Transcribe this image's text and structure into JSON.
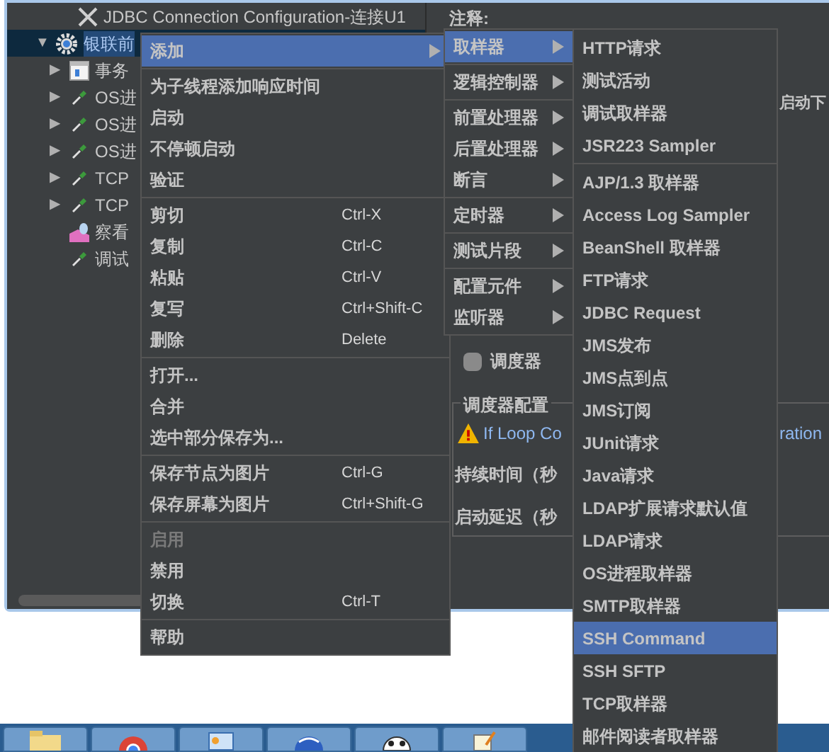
{
  "tree": [
    {
      "label": "JDBC Connection Configuration-连接U1",
      "kind": "config",
      "selected": false
    },
    {
      "label": "银联前",
      "kind": "thread-group",
      "toggle": "▼",
      "selected": true
    },
    {
      "label": "事务",
      "kind": "controller",
      "toggle": "▶",
      "selected": false
    },
    {
      "label": "OS进",
      "kind": "sampler",
      "toggle": "▶",
      "selected": false
    },
    {
      "label": "OS进",
      "kind": "sampler",
      "toggle": "▶",
      "selected": false
    },
    {
      "label": "OS进",
      "kind": "sampler",
      "toggle": "▶",
      "selected": false
    },
    {
      "label": "TCP",
      "kind": "sampler",
      "toggle": "▶",
      "selected": false
    },
    {
      "label": "TCP",
      "kind": "sampler",
      "toggle": "▶",
      "selected": false
    },
    {
      "label": "察看",
      "kind": "listener",
      "selected": false
    },
    {
      "label": "调试",
      "kind": "sampler",
      "selected": false
    }
  ],
  "right_panel": {
    "comment_label": "注释:",
    "next_label": "启动下",
    "scheduler_checkbox": {
      "label": "调度器",
      "checked": false
    },
    "scheduler_group": "调度器配置",
    "warning_start": "If Loop Co",
    "warning_end": "ration",
    "duration_label": "持续时间（秒",
    "delay_label": "启动延迟（秒"
  },
  "context_menu": [
    {
      "kind": "item",
      "label": "添加",
      "submenu": true,
      "selected": true,
      "disabled": false
    },
    {
      "kind": "separator"
    },
    {
      "kind": "item",
      "label": "为子线程添加响应时间",
      "submenu": false,
      "selected": false,
      "disabled": false
    },
    {
      "kind": "item",
      "label": "启动",
      "submenu": false,
      "selected": false,
      "disabled": false
    },
    {
      "kind": "item",
      "label": "不停顿启动",
      "submenu": false,
      "selected": false,
      "disabled": false
    },
    {
      "kind": "item",
      "label": "验证",
      "submenu": false,
      "selected": false,
      "disabled": false
    },
    {
      "kind": "separator"
    },
    {
      "kind": "item",
      "label": "剪切",
      "shortcut": "Ctrl-X",
      "submenu": false,
      "selected": false,
      "disabled": false
    },
    {
      "kind": "item",
      "label": "复制",
      "shortcut": "Ctrl-C",
      "submenu": false,
      "selected": false,
      "disabled": false
    },
    {
      "kind": "item",
      "label": "粘贴",
      "shortcut": "Ctrl-V",
      "submenu": false,
      "selected": false,
      "disabled": false
    },
    {
      "kind": "item",
      "label": "复写",
      "shortcut": "Ctrl+Shift-C",
      "submenu": false,
      "selected": false,
      "disabled": false
    },
    {
      "kind": "item",
      "label": "删除",
      "shortcut": "Delete",
      "submenu": false,
      "selected": false,
      "disabled": false
    },
    {
      "kind": "separator"
    },
    {
      "kind": "item",
      "label": "打开...",
      "submenu": false,
      "selected": false,
      "disabled": false
    },
    {
      "kind": "item",
      "label": "合并",
      "submenu": false,
      "selected": false,
      "disabled": false
    },
    {
      "kind": "item",
      "label": "选中部分保存为...",
      "submenu": false,
      "selected": false,
      "disabled": false
    },
    {
      "kind": "separator"
    },
    {
      "kind": "item",
      "label": "保存节点为图片",
      "shortcut": "Ctrl-G",
      "submenu": false,
      "selected": false,
      "disabled": false
    },
    {
      "kind": "item",
      "label": "保存屏幕为图片",
      "shortcut": "Ctrl+Shift-G",
      "submenu": false,
      "selected": false,
      "disabled": false
    },
    {
      "kind": "separator"
    },
    {
      "kind": "item",
      "label": "启用",
      "submenu": false,
      "selected": false,
      "disabled": true
    },
    {
      "kind": "item",
      "label": "禁用",
      "submenu": false,
      "selected": false,
      "disabled": false
    },
    {
      "kind": "item",
      "label": "切换",
      "shortcut": "Ctrl-T",
      "submenu": false,
      "selected": false,
      "disabled": false
    },
    {
      "kind": "separator"
    },
    {
      "kind": "item",
      "label": "帮助",
      "submenu": false,
      "selected": false,
      "disabled": false
    }
  ],
  "add_submenu": [
    {
      "kind": "item",
      "label": "取样器",
      "submenu": true,
      "selected": true,
      "disabled": false
    },
    {
      "kind": "separator"
    },
    {
      "kind": "item",
      "label": "逻辑控制器",
      "submenu": true,
      "selected": false,
      "disabled": false
    },
    {
      "kind": "separator"
    },
    {
      "kind": "item",
      "label": "前置处理器",
      "submenu": true,
      "selected": false,
      "disabled": false
    },
    {
      "kind": "item",
      "label": "后置处理器",
      "submenu": true,
      "selected": false,
      "disabled": false
    },
    {
      "kind": "item",
      "label": "断言",
      "submenu": true,
      "selected": false,
      "disabled": false
    },
    {
      "kind": "separator"
    },
    {
      "kind": "item",
      "label": "定时器",
      "submenu": true,
      "selected": false,
      "disabled": false
    },
    {
      "kind": "separator"
    },
    {
      "kind": "item",
      "label": "测试片段",
      "submenu": true,
      "selected": false,
      "disabled": false
    },
    {
      "kind": "separator"
    },
    {
      "kind": "item",
      "label": "配置元件",
      "submenu": true,
      "selected": false,
      "disabled": false
    },
    {
      "kind": "item",
      "label": "监听器",
      "submenu": true,
      "selected": false,
      "disabled": false
    }
  ],
  "sampler_submenu": [
    {
      "kind": "item",
      "label": "HTTP请求",
      "submenu": false,
      "selected": false,
      "disabled": false
    },
    {
      "kind": "item",
      "label": "测试活动",
      "submenu": false,
      "selected": false,
      "disabled": false
    },
    {
      "kind": "item",
      "label": "调试取样器",
      "submenu": false,
      "selected": false,
      "disabled": false
    },
    {
      "kind": "item",
      "label": "JSR223 Sampler",
      "submenu": false,
      "selected": false,
      "disabled": false
    },
    {
      "kind": "separator"
    },
    {
      "kind": "item",
      "label": "AJP/1.3 取样器",
      "submenu": false,
      "selected": false,
      "disabled": false
    },
    {
      "kind": "item",
      "label": "Access Log Sampler",
      "submenu": false,
      "selected": false,
      "disabled": false
    },
    {
      "kind": "item",
      "label": "BeanShell 取样器",
      "submenu": false,
      "selected": false,
      "disabled": false
    },
    {
      "kind": "item",
      "label": "FTP请求",
      "submenu": false,
      "selected": false,
      "disabled": false
    },
    {
      "kind": "item",
      "label": "JDBC Request",
      "submenu": false,
      "selected": false,
      "disabled": false
    },
    {
      "kind": "item",
      "label": "JMS发布",
      "submenu": false,
      "selected": false,
      "disabled": false
    },
    {
      "kind": "item",
      "label": "JMS点到点",
      "submenu": false,
      "selected": false,
      "disabled": false
    },
    {
      "kind": "item",
      "label": "JMS订阅",
      "submenu": false,
      "selected": false,
      "disabled": false
    },
    {
      "kind": "item",
      "label": "JUnit请求",
      "submenu": false,
      "selected": false,
      "disabled": false
    },
    {
      "kind": "item",
      "label": "Java请求",
      "submenu": false,
      "selected": false,
      "disabled": false
    },
    {
      "kind": "item",
      "label": "LDAP扩展请求默认值",
      "submenu": false,
      "selected": false,
      "disabled": false
    },
    {
      "kind": "item",
      "label": "LDAP请求",
      "submenu": false,
      "selected": false,
      "disabled": false
    },
    {
      "kind": "item",
      "label": "OS进程取样器",
      "submenu": false,
      "selected": false,
      "disabled": false
    },
    {
      "kind": "item",
      "label": "SMTP取样器",
      "submenu": false,
      "selected": false,
      "disabled": false
    },
    {
      "kind": "item",
      "label": "SSH Command",
      "submenu": false,
      "selected": true,
      "disabled": false
    },
    {
      "kind": "item",
      "label": "SSH SFTP",
      "submenu": false,
      "selected": false,
      "disabled": false
    },
    {
      "kind": "item",
      "label": "TCP取样器",
      "submenu": false,
      "selected": false,
      "disabled": false
    },
    {
      "kind": "item",
      "label": "邮件阅读者取样器",
      "submenu": false,
      "selected": false,
      "disabled": false
    }
  ],
  "taskbar": [
    {
      "kind": "folder"
    },
    {
      "kind": "browser"
    },
    {
      "kind": "panel"
    },
    {
      "kind": "globe"
    },
    {
      "kind": "panda"
    },
    {
      "kind": "notepad"
    }
  ]
}
